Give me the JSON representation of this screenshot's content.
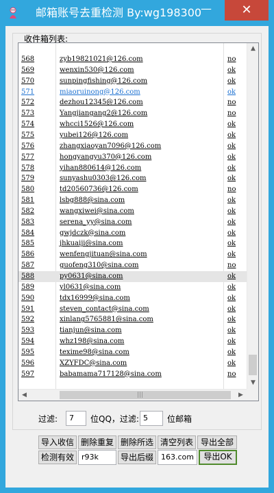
{
  "window": {
    "title": "邮箱账号去重检测  By:wg198300",
    "minimize_glyph": "—",
    "close_glyph": "✕"
  },
  "group": {
    "label": "收件箱列表:"
  },
  "list": {
    "rows": [
      {
        "num": "568",
        "email": "zyb19821021@126.com",
        "status": "no"
      },
      {
        "num": "569",
        "email": "wenxin530@126.com",
        "status": "ok"
      },
      {
        "num": "570",
        "email": "sunpingfishing@126.com",
        "status": "ok"
      },
      {
        "num": "571",
        "email": "miaoruinong@126.com",
        "status": "ok"
      },
      {
        "num": "572",
        "email": "dezhou12345@126.com",
        "status": "no"
      },
      {
        "num": "573",
        "email": "Yangjiangang2@126.com",
        "status": "no"
      },
      {
        "num": "574",
        "email": "whcci1526@126.com",
        "status": "ok"
      },
      {
        "num": "575",
        "email": "yubei126@126.com",
        "status": "ok"
      },
      {
        "num": "576",
        "email": "zhangxiaoyan7096@126.com",
        "status": "ok"
      },
      {
        "num": "577",
        "email": "hongyangyu370@126.com",
        "status": "ok"
      },
      {
        "num": "578",
        "email": "yihan880614@126.com",
        "status": "ok"
      },
      {
        "num": "579",
        "email": "sunyashu0303@126.com",
        "status": "ok"
      },
      {
        "num": "580",
        "email": "td20560736@126.com",
        "status": "no"
      },
      {
        "num": "581",
        "email": "lsbg888@sina.com",
        "status": "ok"
      },
      {
        "num": "582",
        "email": "wangxiwei@sina.com",
        "status": "ok"
      },
      {
        "num": "583",
        "email": "serena_yy@sina.com",
        "status": "ok"
      },
      {
        "num": "584",
        "email": "gwjdczk@sina.com",
        "status": "ok"
      },
      {
        "num": "585",
        "email": "jhkuaiji@sina.com",
        "status": "ok"
      },
      {
        "num": "586",
        "email": "wenfengjituan@sina.com",
        "status": "ok"
      },
      {
        "num": "587",
        "email": "guofeng310@sina.com",
        "status": "no"
      },
      {
        "num": "588",
        "email": "py0631@sina.com",
        "status": "ok"
      },
      {
        "num": "589",
        "email": "yl0631@sina.com",
        "status": "ok"
      },
      {
        "num": "590",
        "email": "tdx16999@sina.com",
        "status": "ok"
      },
      {
        "num": "591",
        "email": "steven_contact@sina.com",
        "status": "ok"
      },
      {
        "num": "592",
        "email": "xinlang5765881@sina.com",
        "status": "ok"
      },
      {
        "num": "593",
        "email": "tianjun@sina.com",
        "status": "ok"
      },
      {
        "num": "594",
        "email": "whz198@sina.com",
        "status": "ok"
      },
      {
        "num": "595",
        "email": "texime98@sina.com",
        "status": "ok"
      },
      {
        "num": "596",
        "email": "XZYFDC@sina.com",
        "status": "ok"
      },
      {
        "num": "597",
        "email": "babamama717128@sina.com",
        "status": "no"
      }
    ],
    "selected_num": "588",
    "highlighted_num": "571"
  },
  "scroll": {
    "up": "▲",
    "down": "▼",
    "left": "◀",
    "right": "▶",
    "grip": "|||"
  },
  "filter": {
    "label1": "过滤:",
    "qq_digits": "7",
    "label2": "位QQ，过滤:",
    "mail_digits": "5",
    "label3": "位邮箱"
  },
  "buttons": {
    "import": "导入收信",
    "dedupe": "删除重复",
    "delete_selected": "删除所选",
    "clear": "清空列表",
    "export_all": "导出全部",
    "check_valid": "检测有效",
    "export_suffix": "导出后缀",
    "export_ok": "导出OK"
  },
  "inputs": {
    "suffix_left": "r93k",
    "suffix_right": "163.com"
  },
  "colors": {
    "titlebar": "#32a7dd",
    "close": "#c7483a",
    "link": "#1a6fd0",
    "accent_border": "#4f8a2c"
  }
}
